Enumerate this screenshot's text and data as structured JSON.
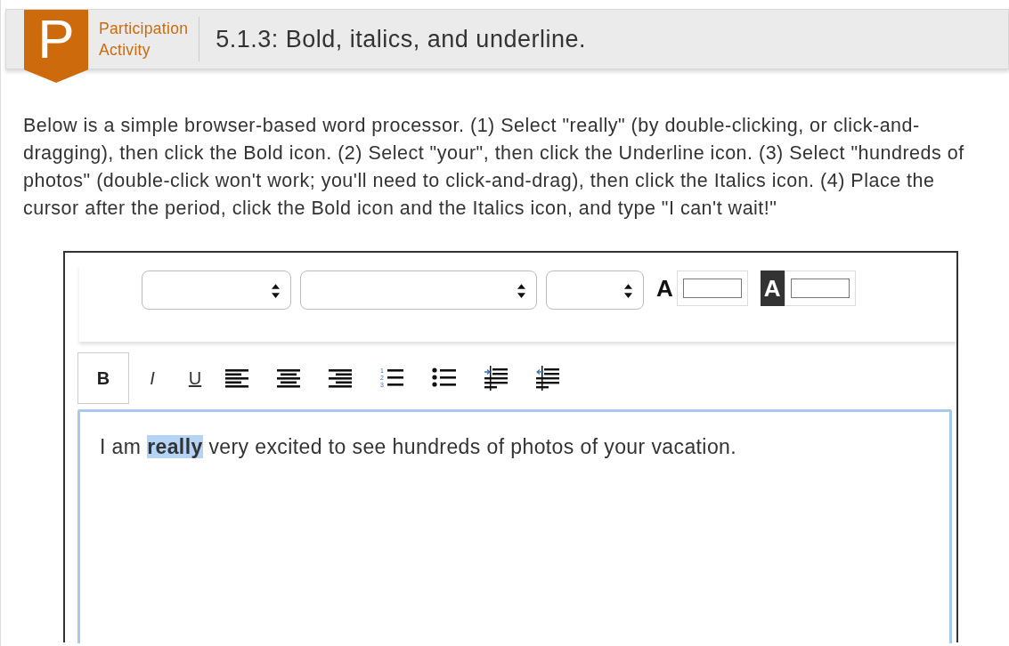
{
  "header": {
    "badge": "P",
    "label_line1": "Participation",
    "label_line2": "Activity",
    "title": "5.1.3: Bold, italics, and underline."
  },
  "instructions": "Below is a simple browser-based word processor. (1) Select \"really\" (by double-clicking, or click-and-dragging), then click the Bold icon. (2) Select \"your\", then click the Underline icon. (3) Select \"hundreds of photos\" (double-click won't work; you'll need to click-and-drag), then click the Italics icon. (4) Place the cursor after the period, click the Bold icon and the Italics icon, and type \"I can't wait!\"",
  "style_bar": {
    "colors": [
      {
        "label": "A",
        "kind": "text"
      },
      {
        "label": "A",
        "kind": "background"
      }
    ]
  },
  "format_bar": [
    {
      "kind": "bold",
      "label": "B",
      "pressed": true
    },
    {
      "kind": "italic",
      "label": "I",
      "pressed": false
    },
    {
      "kind": "underline",
      "label": "U",
      "pressed": false
    },
    {
      "kind": "align-left",
      "pressed": false
    },
    {
      "kind": "align-center",
      "pressed": false
    },
    {
      "kind": "align-right",
      "pressed": false
    },
    {
      "kind": "numbered-list",
      "numbers": [
        "1",
        "2",
        "3"
      ],
      "pressed": false
    },
    {
      "kind": "bullet-list",
      "pressed": false
    },
    {
      "kind": "indent",
      "pressed": false
    },
    {
      "kind": "outdent",
      "pressed": false
    }
  ],
  "editor": {
    "segments": [
      {
        "text": "I am ",
        "bold": false,
        "selected": false
      },
      {
        "text": "really",
        "bold": true,
        "selected": true
      },
      {
        "text": " very excited to see hundreds of photos of your vacation.",
        "bold": false,
        "selected": false
      }
    ]
  }
}
